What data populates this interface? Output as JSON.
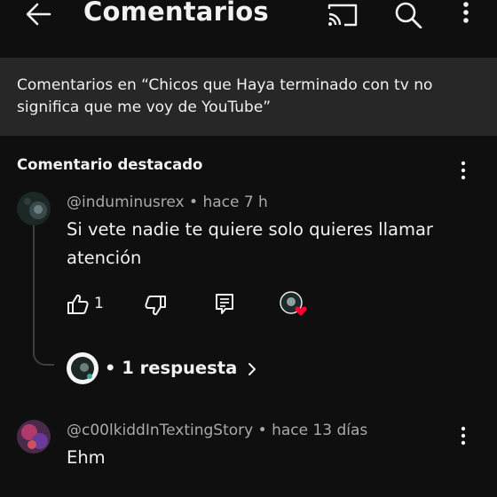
{
  "header": {
    "title": "Comentarios",
    "icons": [
      "back-arrow-icon",
      "cast-icon",
      "search-icon",
      "more-vert-icon"
    ]
  },
  "banner": {
    "text": "Comentarios en “Chicos que Haya terminado con tv no significa que me voy de YouTube”"
  },
  "featured": {
    "section_title": "Comentario destacado",
    "comment": {
      "author": "@induminusrex",
      "separator": "•",
      "time": "hace 7 h",
      "text": "Si vete nadie te quiere solo quieres llamar atención",
      "likes": "1"
    },
    "replies": {
      "bullet": "•",
      "label": "1 respuesta"
    }
  },
  "comments": [
    {
      "author": "@c00lkiddInTextingStory",
      "separator": "•",
      "time": "hace 13 días",
      "text": "Ehm"
    }
  ],
  "colors": {
    "background": "#0f0f0f",
    "banner": "#272727",
    "heart": "#ff0033",
    "muted_text": "#aaaaaa"
  }
}
